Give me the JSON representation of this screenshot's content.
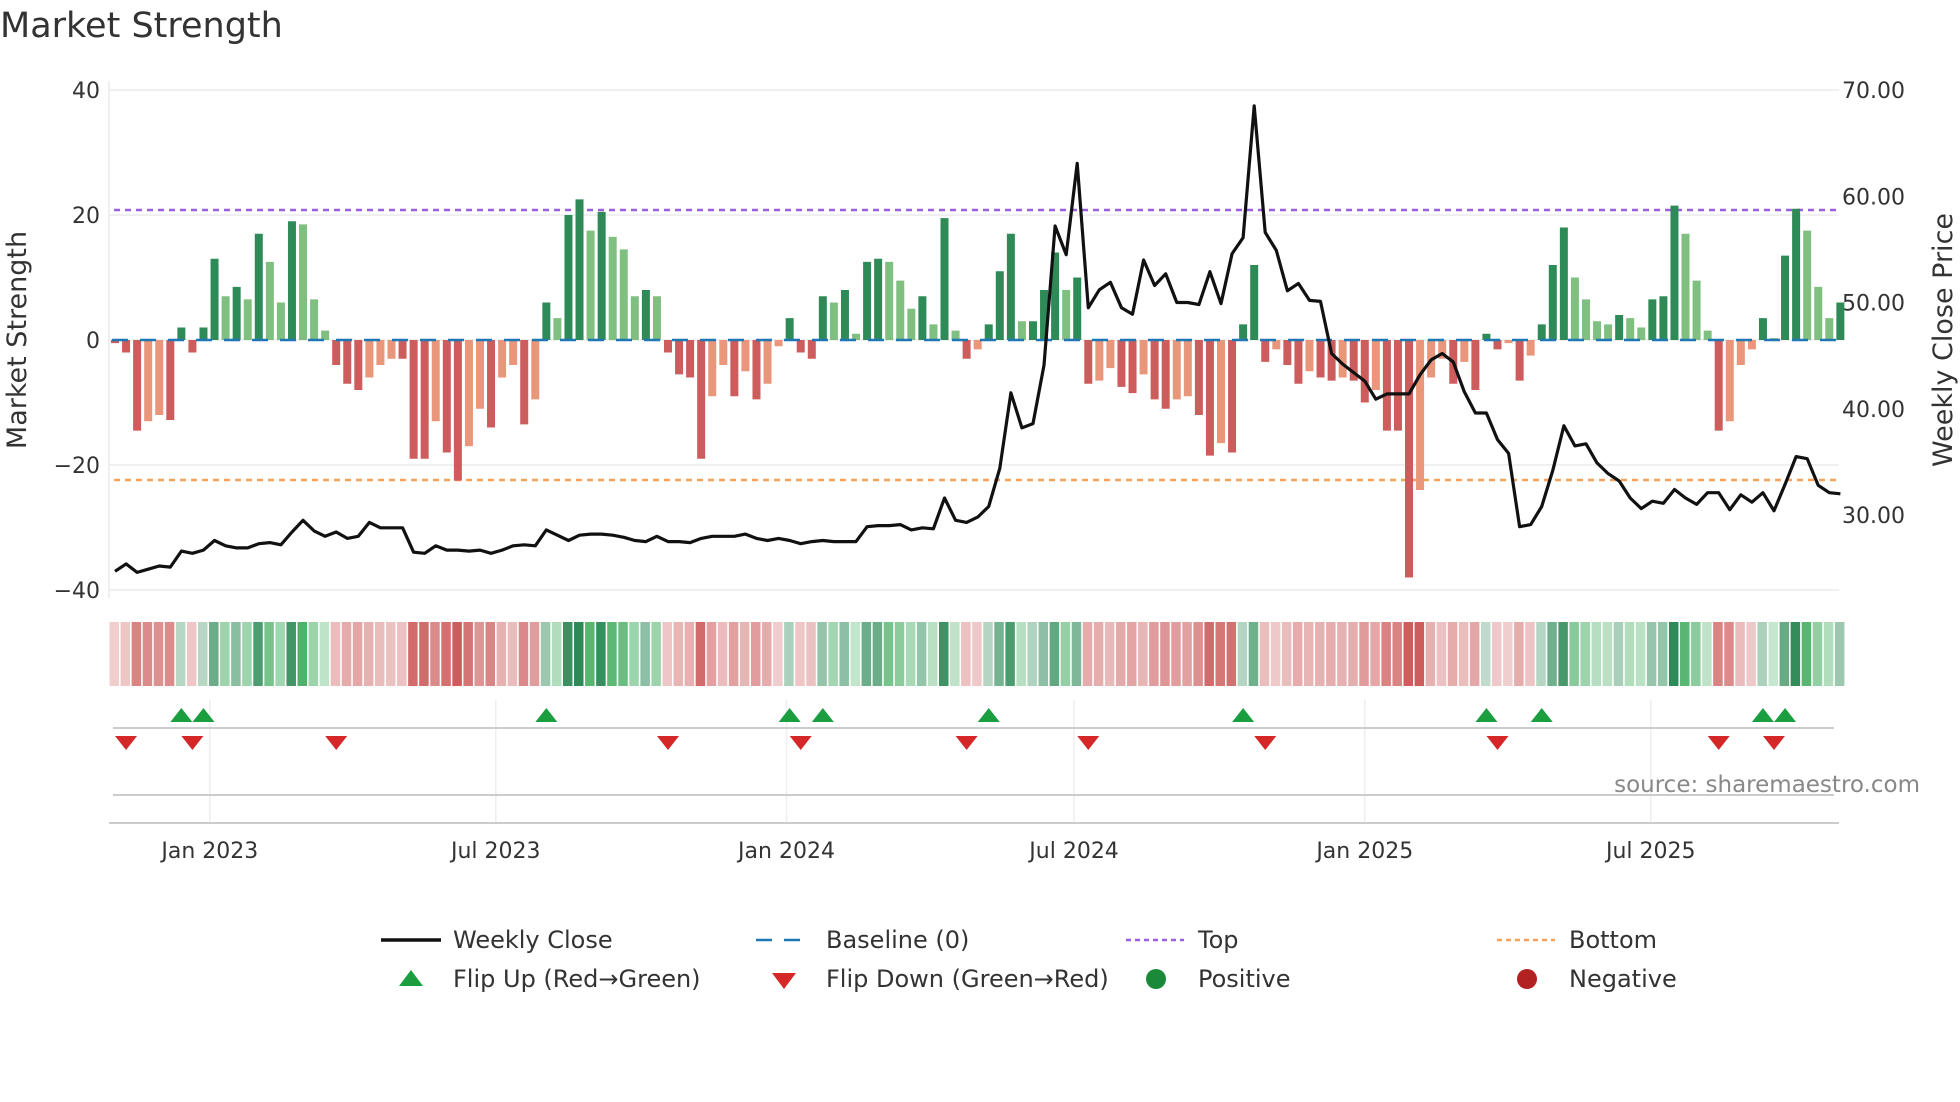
{
  "title": "Market Strength",
  "chart_data": {
    "type": "bar",
    "title": "Market Strength",
    "ylabel": "Market Strength",
    "y2label": "Weekly Close Price",
    "ylim": [
      -40,
      40
    ],
    "y2lim": [
      30,
      70
    ],
    "yticks": [
      "40",
      "20",
      "0",
      "−20",
      "−40"
    ],
    "yticks_values": [
      40,
      20,
      0,
      -20,
      -40
    ],
    "y2ticks": [
      "70.00",
      "60.00",
      "50.00",
      "40.00",
      "30.00"
    ],
    "y2ticks_values": [
      70,
      60,
      50,
      40,
      30
    ],
    "xticks": [
      "Jan 2023",
      "Jul 2023",
      "Jan 2024",
      "Jul 2024",
      "Jan 2025",
      "Jul 2025"
    ],
    "xticks_dates": [
      "2023-01-01",
      "2023-07-01",
      "2024-01-01",
      "2024-07-01",
      "2025-01-01",
      "2025-07-01"
    ],
    "start_date": "2022-11-02",
    "interval": "weekly",
    "top_level": 20.8,
    "bottom_level": -22.4,
    "baseline": 0,
    "strength": [
      -0.5,
      -2,
      -14.5,
      -13,
      -12,
      -12.8,
      2,
      -2,
      2,
      13,
      7,
      8.5,
      6.5,
      17,
      12.5,
      6,
      19,
      18.5,
      6.5,
      1.5,
      -4,
      -7,
      -8,
      -6,
      -4,
      -3,
      -3,
      -19,
      -19,
      -13,
      -18,
      -22.5,
      -17,
      -11,
      -14,
      -6,
      -4,
      -13.5,
      -9.5,
      6,
      3.5,
      20,
      22.5,
      17.5,
      20.5,
      16.5,
      14.5,
      7,
      8,
      7,
      -2,
      -5.5,
      -6,
      -19,
      -9,
      -4,
      -9,
      -5,
      -9.5,
      -7,
      -1,
      3.5,
      -2,
      -3,
      7,
      6,
      8,
      1,
      12.5,
      13,
      12.5,
      9.5,
      5,
      7,
      2.5,
      19.5,
      1.5,
      -3,
      -1.5,
      2.5,
      11,
      17,
      3,
      3,
      8,
      14,
      8,
      10,
      -7,
      -6.5,
      -4.5,
      -7.5,
      -8.5,
      -5.5,
      -9.5,
      -11,
      -9.5,
      -9,
      -12,
      -18.5,
      -16.5,
      -18,
      2.5,
      12,
      -3.5,
      -1.5,
      -4,
      -7,
      -5,
      -6,
      -6.5,
      -6,
      -6.5,
      -10,
      -8,
      -14.5,
      -14.5,
      -38,
      -24,
      -6,
      -3,
      -7,
      -3.5,
      -8,
      1,
      -1.5,
      -0.5,
      -6.5,
      -2.5,
      2.5,
      12,
      18,
      10,
      6.5,
      3,
      2.5,
      4,
      3.5,
      2,
      6.5,
      7,
      21.5,
      17,
      9.5,
      1.5,
      -14.5,
      -13,
      -4,
      -1.5,
      3.5,
      0.3,
      13.5,
      21,
      17.5,
      8.5,
      3.5,
      6
    ],
    "close": [
      24.7,
      25.4,
      24.6,
      24.9,
      25.2,
      25.1,
      26.6,
      26.4,
      26.7,
      27.6,
      27.1,
      26.9,
      26.9,
      27.3,
      27.4,
      27.2,
      28.4,
      29.5,
      28.5,
      28.0,
      28.4,
      27.8,
      28.0,
      29.3,
      28.8,
      28.8,
      28.8,
      26.5,
      26.4,
      27.1,
      26.7,
      26.7,
      26.6,
      26.7,
      26.4,
      26.7,
      27.1,
      27.2,
      27.1,
      28.6,
      28.1,
      27.6,
      28.1,
      28.2,
      28.2,
      28.1,
      27.9,
      27.6,
      27.5,
      28.0,
      27.5,
      27.5,
      27.4,
      27.8,
      28.0,
      28.0,
      28.0,
      28.2,
      27.8,
      27.6,
      27.8,
      27.6,
      27.3,
      27.5,
      27.6,
      27.5,
      27.5,
      27.5,
      28.9,
      29.0,
      29.0,
      29.1,
      28.6,
      28.8,
      28.7,
      31.6,
      29.5,
      29.3,
      29.8,
      30.8,
      34.4,
      41.5,
      38.2,
      38.6,
      44.1,
      57.2,
      54.5,
      63.1,
      49.5,
      51.2,
      51.9,
      49.5,
      48.9,
      54.0,
      51.6,
      52.7,
      50.0,
      50.0,
      49.8,
      52.9,
      49.9,
      54.6,
      56.1,
      68.5,
      56.6,
      54.9,
      51.1,
      51.8,
      50.2,
      50.1,
      45.2,
      44.2,
      43.4,
      42.6,
      40.9,
      41.4,
      41.4,
      41.4,
      43.2,
      44.6,
      45.2,
      44.4,
      41.6,
      39.6,
      39.6,
      37.1,
      35.8,
      28.9,
      29.1,
      30.8,
      34.2,
      38.4,
      36.5,
      36.7,
      34.9,
      33.9,
      33.2,
      31.6,
      30.6,
      31.3,
      31.1,
      32.4,
      31.6,
      31.0,
      32.1,
      32.1,
      30.5,
      31.9,
      31.2,
      32.1,
      30.4,
      32.9,
      35.5,
      35.3,
      32.8,
      32.1,
      32.0
    ],
    "flip_up_indices": [
      6,
      8,
      39,
      61,
      64,
      79,
      102,
      124,
      129,
      149,
      151
    ],
    "flip_down_indices": [
      1,
      7,
      20,
      50,
      62,
      77,
      88,
      104,
      125,
      145,
      150
    ],
    "legend": [
      {
        "label": "Weekly Close",
        "kind": "line-solid",
        "color": "#111111"
      },
      {
        "label": "Baseline (0)",
        "kind": "line-dash",
        "color": "#1f77b4"
      },
      {
        "label": "Top",
        "kind": "line-dot",
        "color": "#9b5fe0"
      },
      {
        "label": "Bottom",
        "kind": "line-dot",
        "color": "#f4a259"
      },
      {
        "label": "Flip Up (Red→Green)",
        "kind": "triangle-up",
        "color": "#1a9e3f"
      },
      {
        "label": "Flip Down (Green→Red)",
        "kind": "triangle-down",
        "color": "#d62728"
      },
      {
        "label": "Positive",
        "kind": "circle",
        "color": "#1a8a3a"
      },
      {
        "label": "Negative",
        "kind": "circle",
        "color": "#b22222"
      }
    ],
    "legend_placement": "bottom",
    "colors": {
      "pos_up": "#2e8b57",
      "pos_down": "#7fbf7f",
      "neg_down": "#cd5c5c",
      "neg_up": "#e9967a",
      "top": "#9b5fe0",
      "bottom": "#f4a259",
      "baseline": "#1f77b4",
      "close": "#111111"
    }
  },
  "source": "source: sharemaestro.com"
}
